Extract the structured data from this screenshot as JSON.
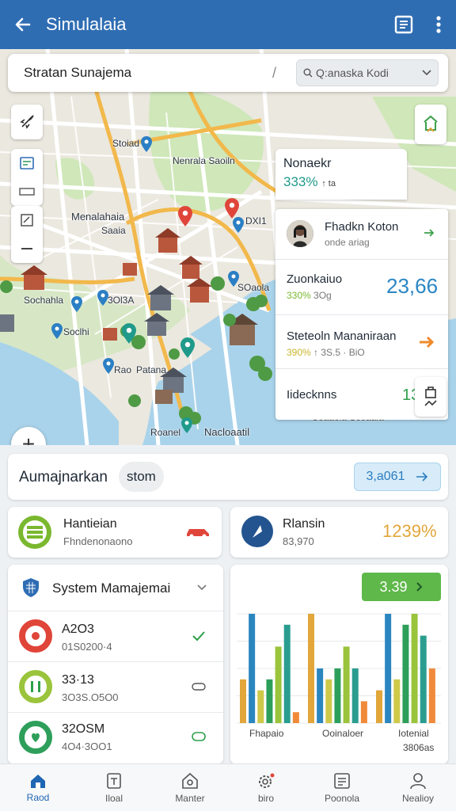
{
  "app_bar": {
    "title": "Simulalaia"
  },
  "search": {
    "location": "Stratan Sunajema",
    "placeholder": "Q:anaska Kodi"
  },
  "map": {
    "labels": [
      "Stoiad",
      "Nenrala Saoiln",
      "Menalahaia",
      "Saaia",
      "DXI1",
      "Sochahla",
      "3Ol3A",
      "SOaola",
      "Soclhi",
      "Rao",
      "Patana",
      "Roanel",
      "Nacloaatil",
      "Soaaola Scoaala"
    ]
  },
  "stat_top": {
    "title": "Nonaekr",
    "value": "333%",
    "sub": "↑ ta"
  },
  "panel": {
    "person": {
      "name": "Fhadkn Koton",
      "subtitle": "onde ariag"
    },
    "row2": {
      "title": "Zuonkaiuo",
      "value": "23,66",
      "pct": "330%",
      "sub": "3Og"
    },
    "row3": {
      "title": "Steteoln Mananiraan",
      "pct": "390%",
      "sub": "↑ 3S.5 · BiO"
    },
    "row4": {
      "title": "Iidecknns",
      "value": "136K"
    }
  },
  "summary": {
    "label": "Aumajnarkan",
    "chip": "stom",
    "value": "3,a061"
  },
  "card_left": {
    "title": "Hantieian",
    "subtitle": "Fhndenonaono"
  },
  "card_right": {
    "title": "Rlansin",
    "subtitle": "83,970",
    "value": "1239%"
  },
  "system": {
    "title": "System Mamajemai",
    "rows": [
      {
        "value": "A2O3",
        "sub": "01S0200·4"
      },
      {
        "value": "33·13",
        "sub": "3O3S.O5O0"
      },
      {
        "value": "32OSM",
        "sub": "4O4·3OO1"
      }
    ]
  },
  "chart_data": {
    "type": "bar",
    "badge": "3.39",
    "categories": [
      "Fhapaio",
      "Ooinaloer",
      "Iotenial"
    ],
    "footnote": "3806as",
    "series": [
      {
        "values": [
          4,
          10,
          3
        ]
      },
      {
        "values": [
          10,
          5,
          10
        ]
      },
      {
        "values": [
          3,
          4,
          4
        ]
      },
      {
        "values": [
          4,
          5,
          9
        ]
      },
      {
        "values": [
          7,
          7,
          10
        ]
      },
      {
        "values": [
          9,
          5,
          8
        ]
      },
      {
        "values": [
          1,
          2,
          5
        ]
      }
    ],
    "ylim": [
      0,
      10
    ],
    "colors": [
      "#e2a63a",
      "#2b86bf",
      "#cfc94a",
      "#2e9f5a",
      "#9ac43b",
      "#2a9d8f",
      "#f08a3a"
    ]
  },
  "bottom_nav": [
    {
      "label": "Raod",
      "icon": "home-icon"
    },
    {
      "label": "Iloal",
      "icon": "doc-icon"
    },
    {
      "label": "Manter",
      "icon": "house-icon"
    },
    {
      "label": "biro",
      "icon": "gear-icon"
    },
    {
      "label": "Poonola",
      "icon": "report-icon"
    },
    {
      "label": "Nealioy",
      "icon": "user-icon"
    }
  ],
  "colors": {
    "app_bar": "#2f6db3",
    "accent_blue": "#1f66b3",
    "water": "#a9d3ea",
    "park": "#cfe7b9"
  }
}
